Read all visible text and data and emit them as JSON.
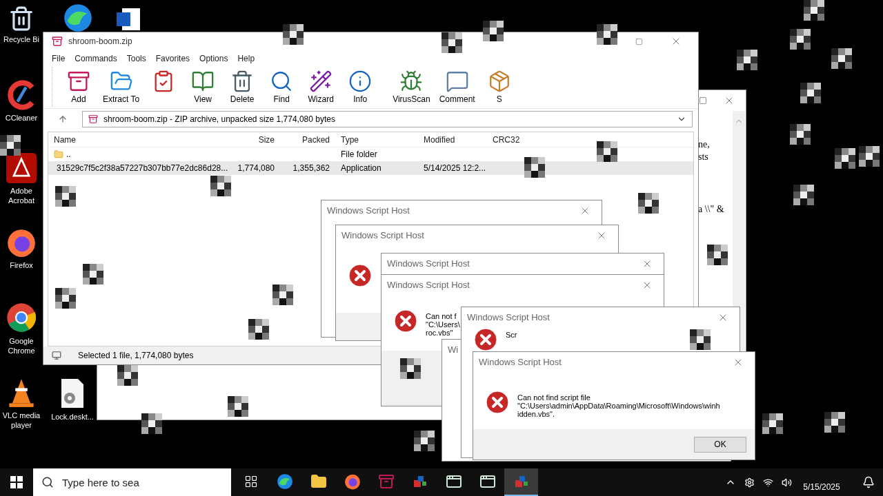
{
  "desktop_icons": [
    {
      "kind": "recycle",
      "label": "Recycle Bi"
    },
    {
      "kind": "edge"
    },
    {
      "kind": "word"
    },
    {
      "kind": "ccleaner",
      "label": "CCleaner"
    },
    {
      "kind": "acrobat",
      "label": "Adobe Acrobat"
    },
    {
      "kind": "firefox",
      "label": "Firefox"
    },
    {
      "kind": "chrome",
      "label": "Google Chrome"
    },
    {
      "kind": "vlc",
      "label": "VLC media player"
    },
    {
      "kind": "file",
      "label": "Lock.deskt..."
    }
  ],
  "document_window": {
    "text_lines": [
      "ne,",
      "sts",
      "a \\\\\" &"
    ]
  },
  "winrar": {
    "title": "shroom-boom.zip",
    "menu": [
      "File",
      "Commands",
      "Tools",
      "Favorites",
      "Options",
      "Help"
    ],
    "toolbar": [
      {
        "kind": "add",
        "label": "Add"
      },
      {
        "kind": "extract",
        "label": "Extract To"
      },
      {
        "kind": "test"
      },
      {
        "kind": "view",
        "label": "View"
      },
      {
        "kind": "delete",
        "label": "Delete"
      },
      {
        "kind": "find",
        "label": "Find"
      },
      {
        "kind": "wizard",
        "label": "Wizard"
      },
      {
        "kind": "info",
        "label": "Info"
      },
      {
        "kind": "virus",
        "label": "VirusScan"
      },
      {
        "kind": "comment",
        "label": "Comment"
      },
      {
        "kind": "sfx",
        "label": "S"
      }
    ],
    "address": "shroom-boom.zip - ZIP archive, unpacked size 1,774,080 bytes",
    "columns": [
      "Name",
      "Size",
      "Packed",
      "Type",
      "Modified",
      "CRC32"
    ],
    "rows": [
      {
        "kind": "folder",
        "name": "..",
        "type": "File folder",
        "selected": false
      },
      {
        "kind": "app",
        "name": "31529c7f5c2f38a57227b307bb77e2dc86d28...",
        "size": "1,774,080",
        "packed": "1,355,362",
        "type": "Application",
        "modified": "5/14/2025 12:2...",
        "selected": true
      }
    ],
    "status": "Selected 1 file, 1,774,080 bytes"
  },
  "dialogs": [
    {
      "title": "Windows Script Host"
    },
    {
      "title": "Windows Script Host",
      "error_icon": true
    },
    {
      "title": "Windows Script Host"
    },
    {
      "title": "Windows Script Host",
      "error_icon": true,
      "message": [
        "Can not f",
        "\"C:\\Users\\",
        "roc.vbs\""
      ]
    },
    {
      "title": "Wi"
    },
    {
      "title": "Windows Script Host",
      "error_icon": true,
      "message": [
        "Scr"
      ]
    },
    {
      "title": "Windows Script Host",
      "error_icon": true,
      "message": [
        "Can not find script file",
        "\"C:\\Users\\admin\\AppData\\Roaming\\Microsoft\\Windows\\winh",
        "idden.vbs\"."
      ],
      "button": "OK"
    }
  ],
  "taskbar": {
    "search_placeholder": "Type here to sea",
    "apps": [
      {
        "kind": "taskview",
        "selected": false
      },
      {
        "kind": "edge",
        "selected": false
      },
      {
        "kind": "explorer",
        "selected": false
      },
      {
        "kind": "firefox",
        "selected": false
      },
      {
        "kind": "winrar",
        "selected": false
      },
      {
        "kind": "script",
        "selected": false
      },
      {
        "kind": "window",
        "selected": false
      },
      {
        "kind": "window",
        "selected": false
      },
      {
        "kind": "script",
        "selected": true
      }
    ],
    "date": "5/15/2025"
  }
}
